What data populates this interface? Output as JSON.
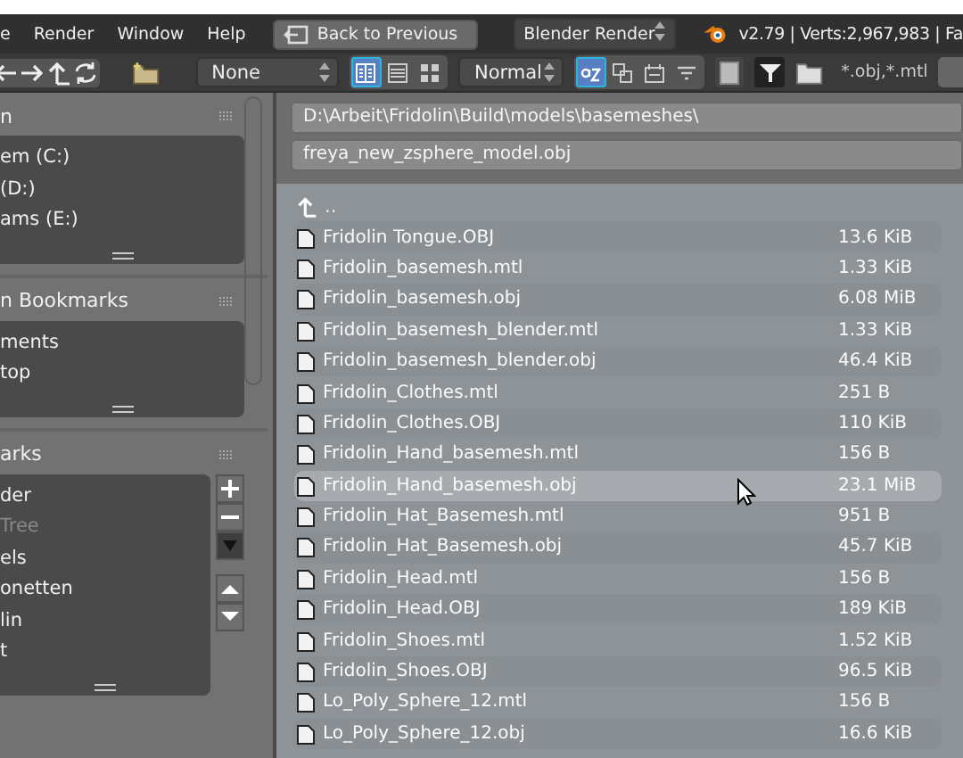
{
  "menu": [
    "e",
    "Render",
    "Window",
    "Help"
  ],
  "back_button": {
    "label": "Back to Previous"
  },
  "engine": {
    "value": "Blender Render"
  },
  "stats": "v2.79 | Verts:2,967,983 | Fa",
  "toolbar": {
    "recursion": "None",
    "display_modes": [
      {
        "kind": "list-short",
        "selected": true
      },
      {
        "kind": "list-long",
        "selected": false
      },
      {
        "kind": "thumbnails",
        "selected": false
      }
    ],
    "thumb_size": "Normal",
    "sort_modes": [
      {
        "kind": "alpha",
        "selected": true
      },
      {
        "kind": "ext",
        "selected": false
      },
      {
        "kind": "date",
        "selected": false
      },
      {
        "kind": "size",
        "selected": false
      }
    ],
    "hide_dot": false,
    "filter": true,
    "filter_text": "*.obj,*.mtl"
  },
  "sidebar": [
    {
      "title": "n",
      "items": [
        {
          "label": "em (C:)",
          "muted": false
        },
        {
          "label": "(D:)",
          "muted": false
        },
        {
          "label": "ams (E:)",
          "muted": false
        }
      ],
      "controls": false
    },
    {
      "title": "n Bookmarks",
      "items": [
        {
          "label": "ments",
          "muted": false
        },
        {
          "label": "top",
          "muted": false
        }
      ],
      "controls": false
    },
    {
      "title": "arks",
      "items": [
        {
          "label": "der",
          "muted": false
        },
        {
          "label": "Tree",
          "muted": true
        },
        {
          "label": "els",
          "muted": false
        },
        {
          "label": "onetten",
          "muted": false
        },
        {
          "label": "lin",
          "muted": false
        },
        {
          "label": "t",
          "muted": false
        }
      ],
      "controls": true
    }
  ],
  "path": "D:\\Arbeit\\Fridolin\\Build\\models\\basemeshes\\",
  "filename": "freya_new_zsphere_model.obj",
  "parent": "..",
  "files": [
    {
      "name": "Fridolin Tongue.OBJ",
      "size": "13.6 KiB",
      "highlighted": false
    },
    {
      "name": "Fridolin_basemesh.mtl",
      "size": "1.33 KiB",
      "highlighted": false
    },
    {
      "name": "Fridolin_basemesh.obj",
      "size": "6.08 MiB",
      "highlighted": false
    },
    {
      "name": "Fridolin_basemesh_blender.mtl",
      "size": "1.33 KiB",
      "highlighted": false
    },
    {
      "name": "Fridolin_basemesh_blender.obj",
      "size": "46.4 KiB",
      "highlighted": false
    },
    {
      "name": "Fridolin_Clothes.mtl",
      "size": "251 B",
      "highlighted": false
    },
    {
      "name": "Fridolin_Clothes.OBJ",
      "size": "110 KiB",
      "highlighted": false
    },
    {
      "name": "Fridolin_Hand_basemesh.mtl",
      "size": "156 B",
      "highlighted": false
    },
    {
      "name": "Fridolin_Hand_basemesh.obj",
      "size": "23.1 MiB",
      "highlighted": true
    },
    {
      "name": "Fridolin_Hat_Basemesh.mtl",
      "size": "951 B",
      "highlighted": false
    },
    {
      "name": "Fridolin_Hat_Basemesh.obj",
      "size": "45.7 KiB",
      "highlighted": false
    },
    {
      "name": "Fridolin_Head.mtl",
      "size": "156 B",
      "highlighted": false
    },
    {
      "name": "Fridolin_Head.OBJ",
      "size": "189 KiB",
      "highlighted": false
    },
    {
      "name": "Fridolin_Shoes.mtl",
      "size": "1.52 KiB",
      "highlighted": false
    },
    {
      "name": "Fridolin_Shoes.OBJ",
      "size": "96.5 KiB",
      "highlighted": false
    },
    {
      "name": "Lo_Poly_Sphere_12.mtl",
      "size": "156 B",
      "highlighted": false
    },
    {
      "name": "Lo_Poly_Sphere_12.obj",
      "size": "16.6 KiB",
      "highlighted": false
    }
  ]
}
